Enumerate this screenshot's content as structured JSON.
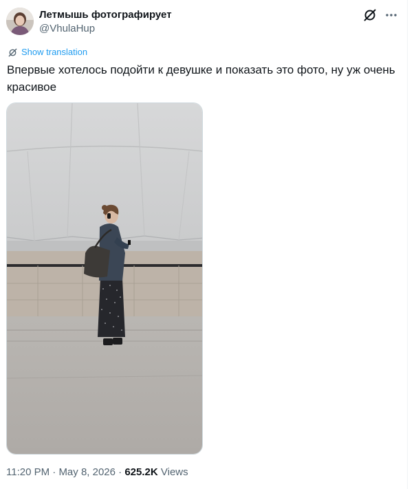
{
  "author": {
    "display_name": "Летмышь фотографирует",
    "handle": "@VhulaHup"
  },
  "actions": {
    "grok_icon": "grok-icon",
    "more_icon": "more-icon"
  },
  "translation": {
    "label": "Show translation",
    "icon": "translate-icon"
  },
  "tweet": {
    "text": "Впервые хотелось подойти к девушке и показать это фото, ну уж очень красивое"
  },
  "meta": {
    "time": "11:20 PM",
    "separator1": " · ",
    "date": "May 8, 2026",
    "separator2": " · ",
    "views_count": "625.2K",
    "views_label": " Views"
  },
  "colors": {
    "accent": "#1d9bf0",
    "text_primary": "#0f1419",
    "text_secondary": "#536471",
    "border": "#cfd9de"
  }
}
